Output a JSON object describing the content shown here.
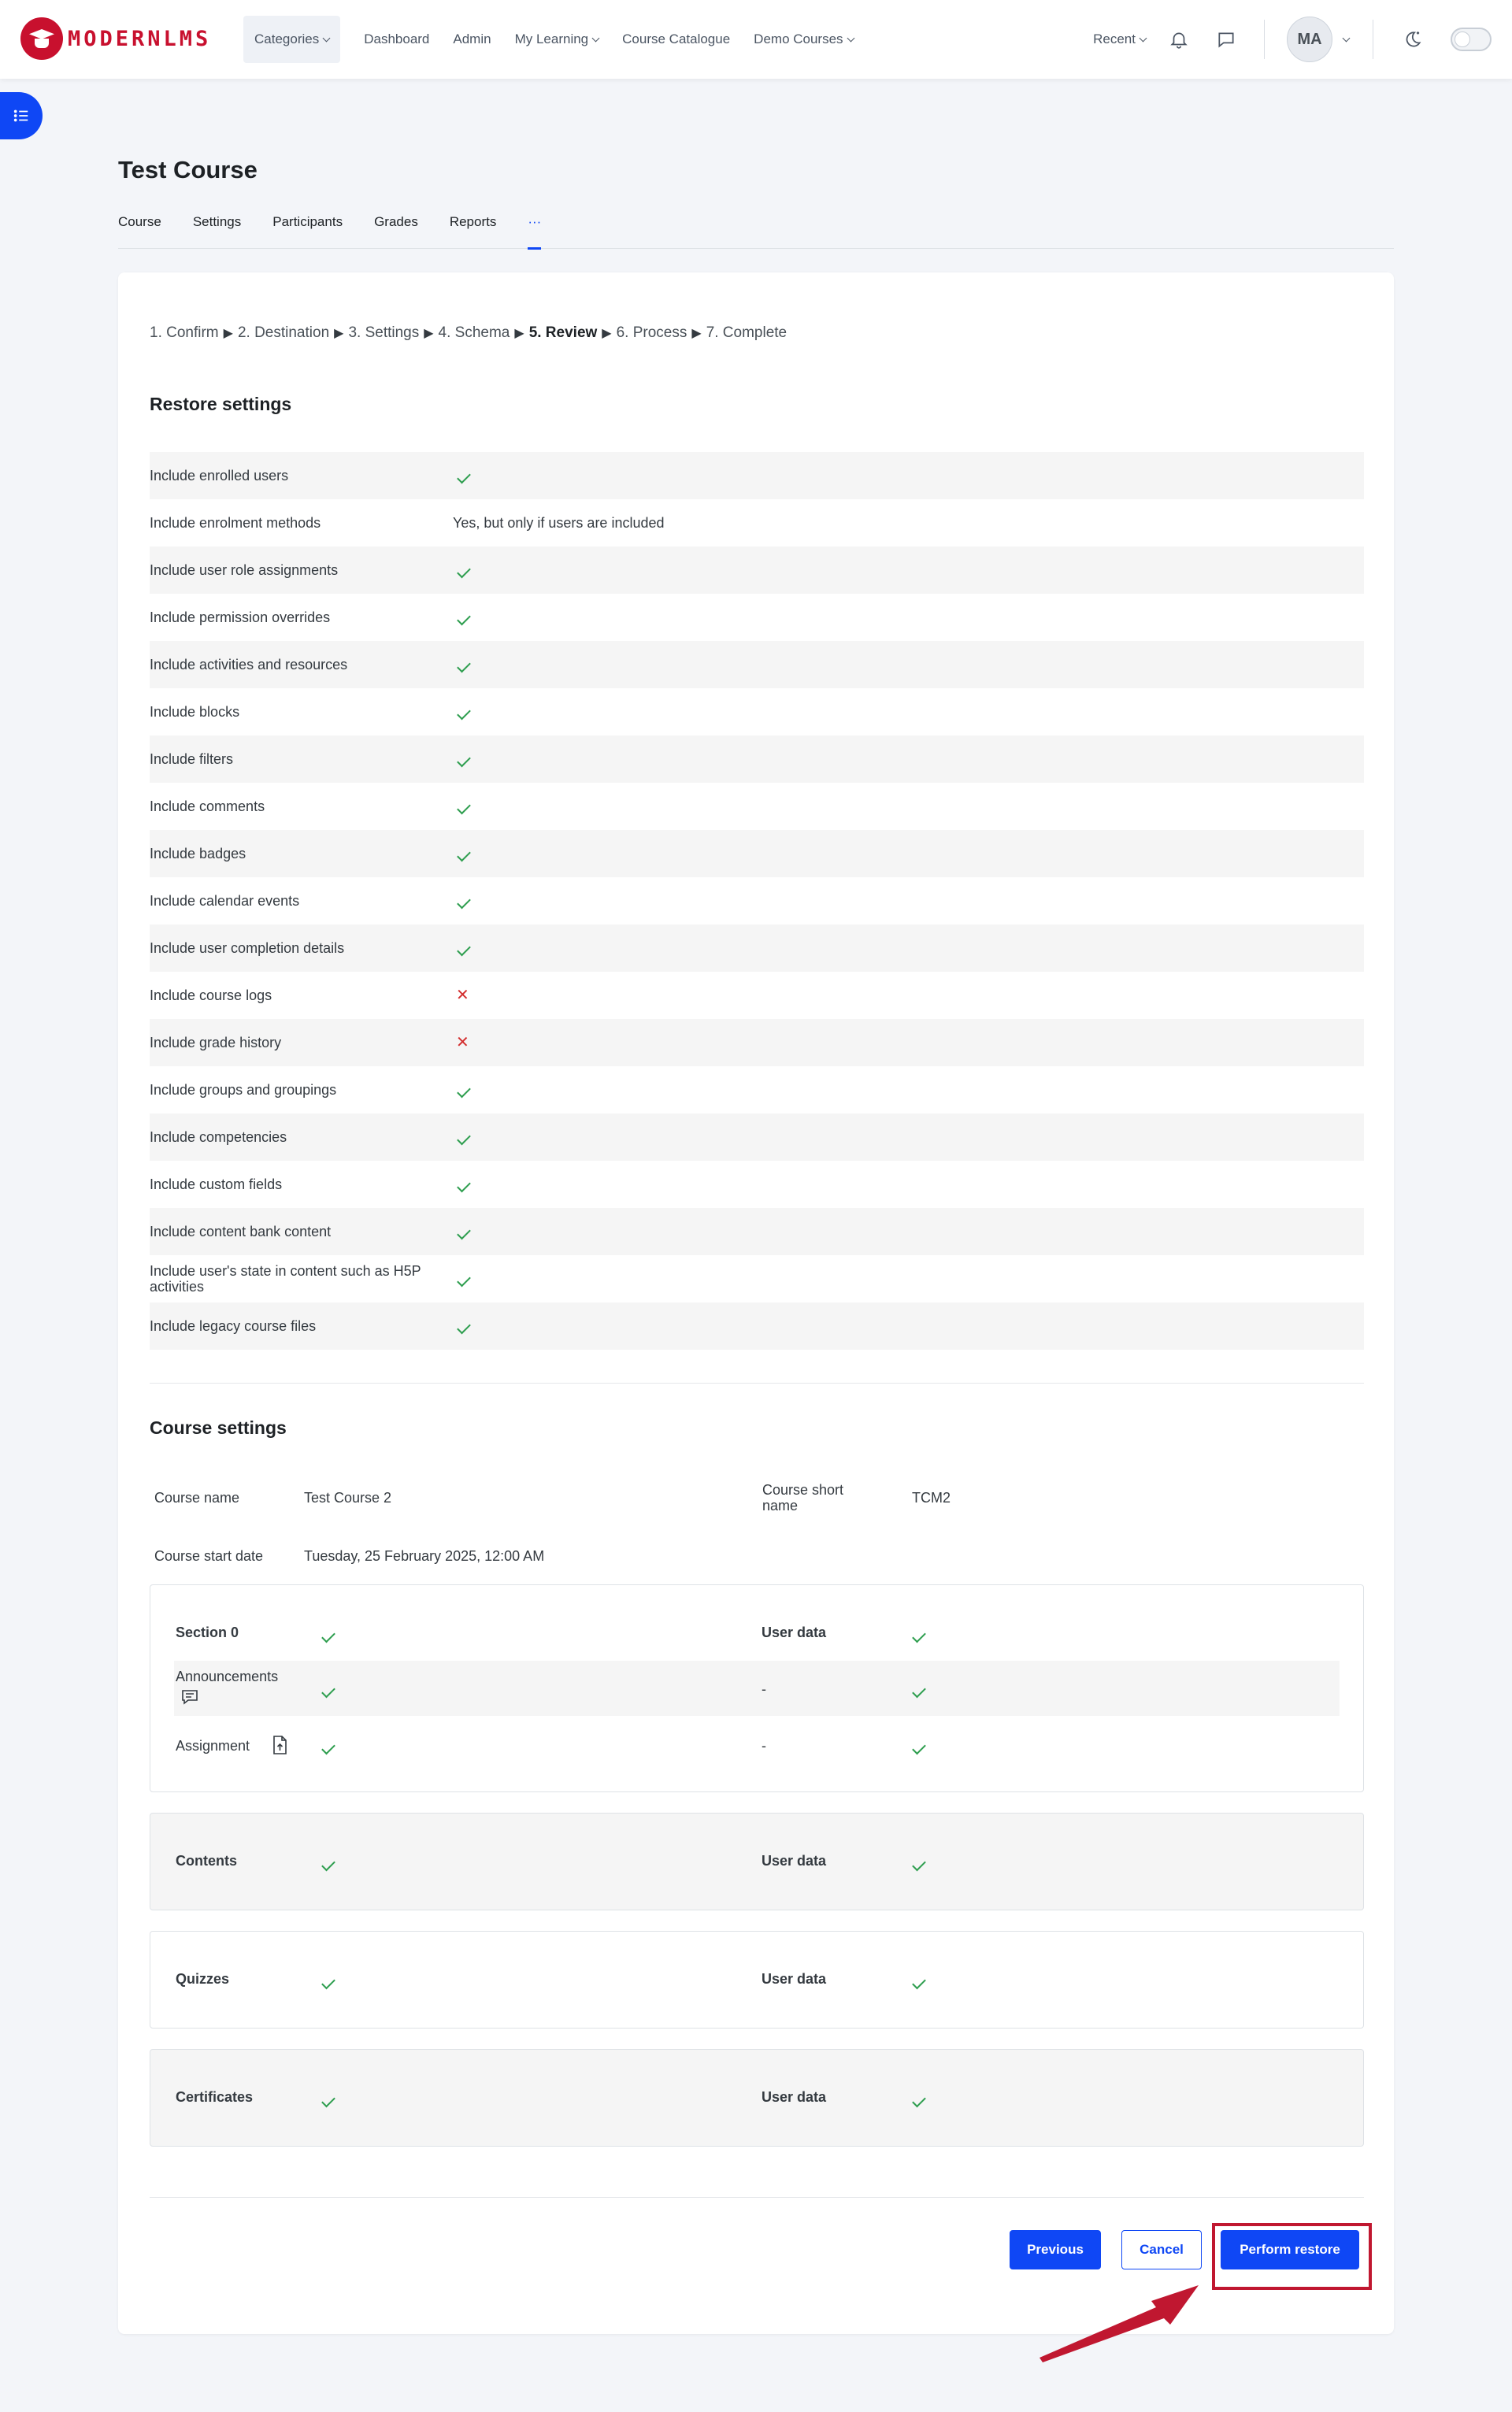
{
  "brand": {
    "name": "MODERNLMS",
    "color": "#c8102e"
  },
  "nav": {
    "links": [
      "Categories",
      "Dashboard",
      "Admin",
      "My Learning",
      "Course Catalogue",
      "Demo Courses"
    ],
    "recent": "Recent",
    "avatar_initials": "MA",
    "icons": [
      "bell-icon",
      "chat-icon",
      "dark-mode-icon"
    ]
  },
  "page": {
    "title": "Test Course",
    "tabs": [
      "Course",
      "Settings",
      "Participants",
      "Grades",
      "Reports",
      "···"
    ]
  },
  "steps": {
    "items": [
      "1. Confirm",
      "2. Destination",
      "3. Settings",
      "4. Schema",
      "5. Review",
      "6. Process",
      "7. Complete"
    ],
    "separator": "▶",
    "current": "5. Review"
  },
  "restore_settings": {
    "heading": "Restore settings",
    "rows": [
      {
        "label": "Include enrolled users",
        "value": "check"
      },
      {
        "label": "Include enrolment methods",
        "value": "Yes, but only if users are included"
      },
      {
        "label": "Include user role assignments",
        "value": "check"
      },
      {
        "label": "Include permission overrides",
        "value": "check"
      },
      {
        "label": "Include activities and resources",
        "value": "check"
      },
      {
        "label": "Include blocks",
        "value": "check"
      },
      {
        "label": "Include filters",
        "value": "check"
      },
      {
        "label": "Include comments",
        "value": "check"
      },
      {
        "label": "Include badges",
        "value": "check"
      },
      {
        "label": "Include calendar events",
        "value": "check"
      },
      {
        "label": "Include user completion details",
        "value": "check"
      },
      {
        "label": "Include course logs",
        "value": "cross"
      },
      {
        "label": "Include grade history",
        "value": "cross"
      },
      {
        "label": "Include groups and groupings",
        "value": "check"
      },
      {
        "label": "Include competencies",
        "value": "check"
      },
      {
        "label": "Include custom fields",
        "value": "check"
      },
      {
        "label": "Include content bank content",
        "value": "check"
      },
      {
        "label": "Include user's state in content such as H5P activities",
        "value": "check"
      },
      {
        "label": "Include legacy course files",
        "value": "check"
      }
    ]
  },
  "course_settings": {
    "heading": "Course settings",
    "course_name_label": "Course name",
    "course_name": "Test Course 2",
    "short_name_label": "Course short name",
    "short_name": "TCM2",
    "start_date_label": "Course start date",
    "start_date": "Tuesday, 25 February 2025, 12:00 AM",
    "user_data_label": "User data",
    "sections": [
      {
        "name": "Section 0",
        "activities": [
          {
            "name": "Announcements",
            "icon": "forum-icon",
            "userdata_dash": "-"
          },
          {
            "name": "Assignment",
            "icon": "assignment-icon",
            "userdata_dash": "-"
          }
        ]
      },
      {
        "name": "Contents"
      },
      {
        "name": "Quizzes"
      },
      {
        "name": "Certificates"
      }
    ]
  },
  "buttons": {
    "previous": "Previous",
    "cancel": "Cancel",
    "perform": "Perform restore"
  },
  "colors": {
    "primary": "#0f47f5",
    "check": "#2e9e4f",
    "cross": "#d32f2f",
    "annotation": "#c01730"
  }
}
